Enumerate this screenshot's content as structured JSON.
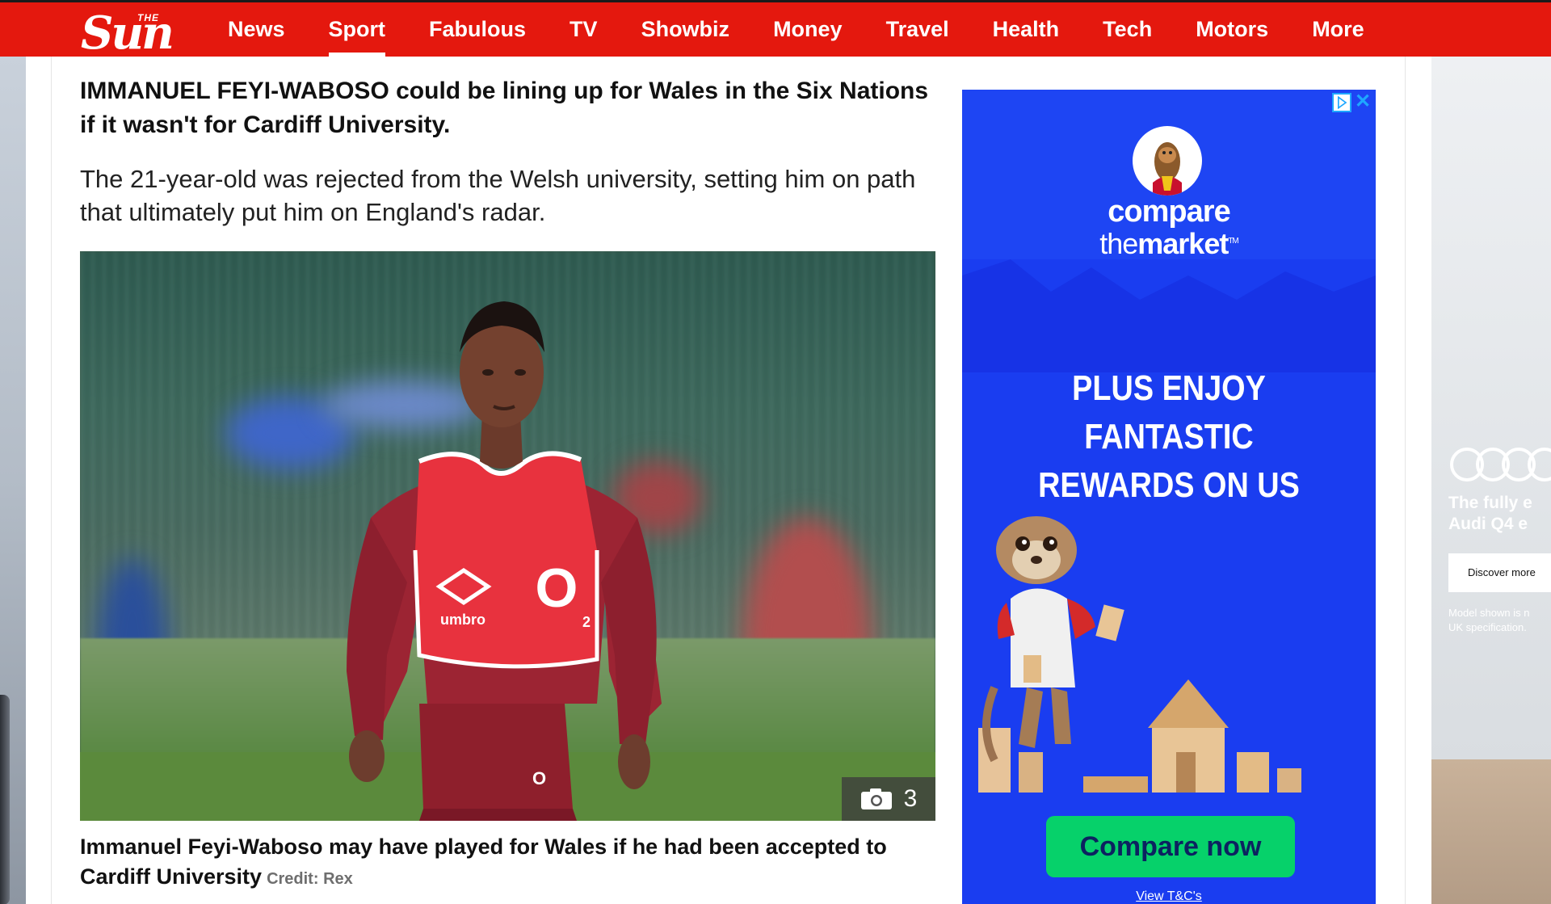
{
  "nav": {
    "logo_the": "THE",
    "logo_sun": "Sun",
    "items": [
      {
        "label": "News"
      },
      {
        "label": "Sport"
      },
      {
        "label": "Fabulous"
      },
      {
        "label": "TV"
      },
      {
        "label": "Showbiz"
      },
      {
        "label": "Money"
      },
      {
        "label": "Travel"
      },
      {
        "label": "Health"
      },
      {
        "label": "Tech"
      },
      {
        "label": "Motors"
      },
      {
        "label": "More"
      }
    ],
    "active": "Sport"
  },
  "article": {
    "lead": "IMMANUEL FEYI-WABOSO could be lining up for Wales in the Six Nations if it wasn't for Cardiff University.",
    "sub": "The 21-year-old was rejected from the Welsh university, setting him on path that ultimately put him on England's radar.",
    "photo": {
      "alt": "Immanuel Feyi-Waboso in England training bib",
      "gallery_count": "3",
      "bib_brand": "umbro",
      "sponsor": "O₂"
    },
    "caption": "Immanuel Feyi-Waboso may have played for Wales if he had been accepted to Cardiff University",
    "credit": "Credit: Rex"
  },
  "ad": {
    "brand_line1": "compare",
    "brand_line2_light": "the",
    "brand_line2_bold": "market",
    "trademark": "TM",
    "headline_line1": "PLUS ENJOY FANTASTIC",
    "headline_line2": "REWARDS ON US",
    "cta": "Compare now",
    "terms": "View T&C's",
    "close_label": "✕",
    "colors": {
      "background": "#1a3df0",
      "cta": "#06d16a"
    }
  },
  "side_ad": {
    "line1": "The fully e",
    "line2": "Audi Q4 e",
    "button": "Discover more",
    "note1": "Model shown is n",
    "note2": "UK specification."
  },
  "colors": {
    "brand_red": "#e4180e"
  }
}
